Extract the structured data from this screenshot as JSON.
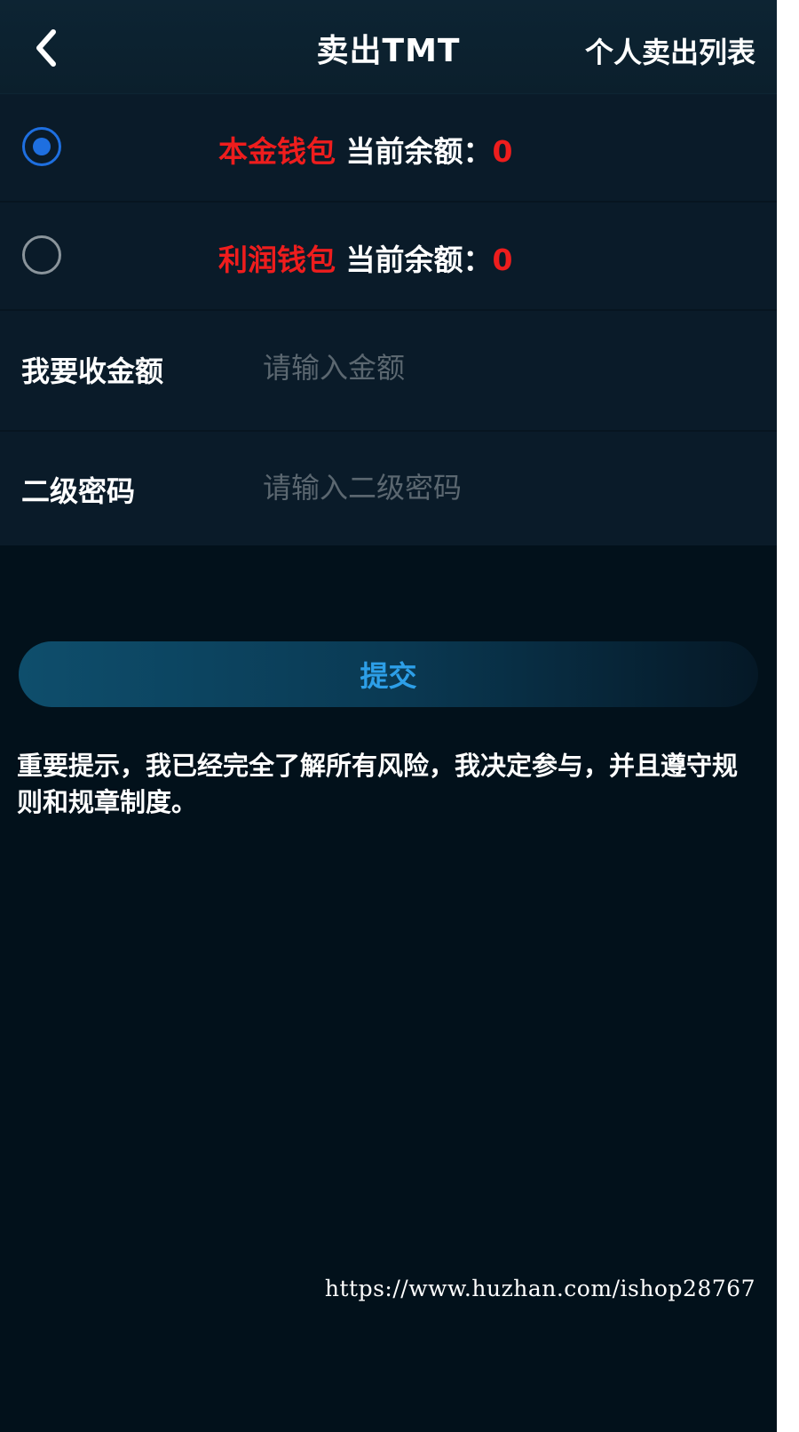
{
  "header": {
    "title": "卖出TMT",
    "right_link": "个人卖出列表"
  },
  "wallets": [
    {
      "name": "本金钱包",
      "balance_label": "当前余额：",
      "balance": "0",
      "selected": true
    },
    {
      "name": "利润钱包",
      "balance_label": "当前余额：",
      "balance": "0",
      "selected": false
    }
  ],
  "form": {
    "amount_label": "我要收金额",
    "amount_placeholder": "请输入金额",
    "amount_value": "",
    "password_label": "二级密码",
    "password_placeholder": "请输入二级密码",
    "password_value": ""
  },
  "submit_label": "提交",
  "notice": "重要提示，我已经完全了解所有风险，我决定参与，并且遵守规则和规章制度。",
  "watermark": "https://www.huzhan.com/ishop28767",
  "colors": {
    "background": "#02111b",
    "panel": "#0a1b29",
    "accent_blue": "#1e6fe0",
    "highlight_red": "#ee1d1d",
    "button_text": "#2d9fe8"
  }
}
